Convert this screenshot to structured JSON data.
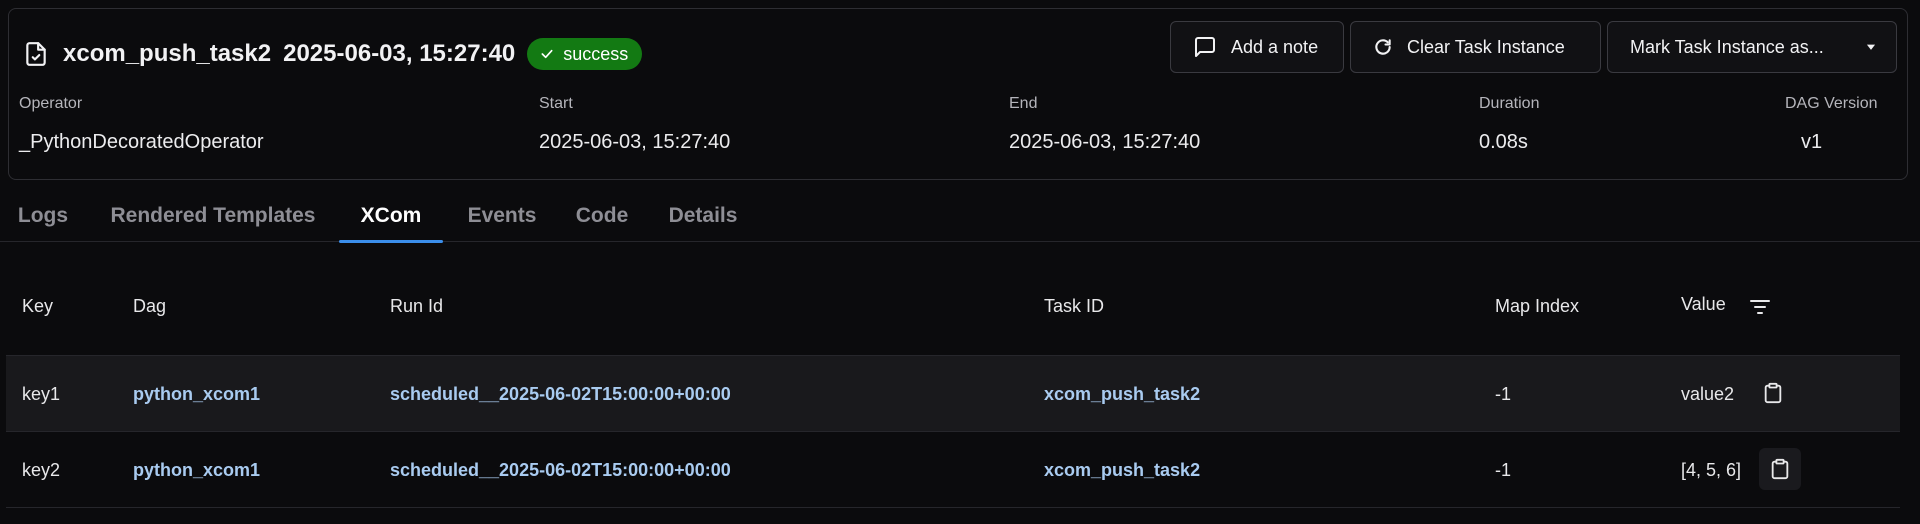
{
  "header": {
    "task_id": "xcom_push_task2",
    "date": "2025-06-03, 15:27:40",
    "status": "success",
    "status_color": "#137a13"
  },
  "actions": {
    "add_note": "Add a note",
    "clear": "Clear Task Instance",
    "mark": "Mark Task Instance as..."
  },
  "meta": {
    "operator_label": "Operator",
    "operator_value": "_PythonDecoratedOperator",
    "start_label": "Start",
    "start_value": "2025-06-03, 15:27:40",
    "end_label": "End",
    "end_value": "2025-06-03, 15:27:40",
    "duration_label": "Duration",
    "duration_value": "0.08s",
    "version_label": "DAG Version",
    "version_value": "v1"
  },
  "tabs": [
    "Logs",
    "Rendered Templates",
    "XCom",
    "Events",
    "Code",
    "Details"
  ],
  "active_tab": "XCom",
  "table": {
    "columns": [
      "Key",
      "Dag",
      "Run Id",
      "Task ID",
      "Map Index",
      "Value"
    ],
    "rows": [
      {
        "key": "key1",
        "dag": "python_xcom1",
        "run_id": "scheduled__2025-06-02T15:00:00+00:00",
        "task_id": "xcom_push_task2",
        "map_index": "-1",
        "value": "value2"
      },
      {
        "key": "key2",
        "dag": "python_xcom1",
        "run_id": "scheduled__2025-06-02T15:00:00+00:00",
        "task_id": "xcom_push_task2",
        "map_index": "-1",
        "value": "[4, 5, 6]"
      }
    ]
  },
  "icons": {
    "title": "document-check-icon",
    "note": "message-square-icon",
    "clear": "refresh-icon",
    "mark": "caret-down-icon",
    "filter": "filter-icon",
    "copy": "clipboard-icon"
  }
}
